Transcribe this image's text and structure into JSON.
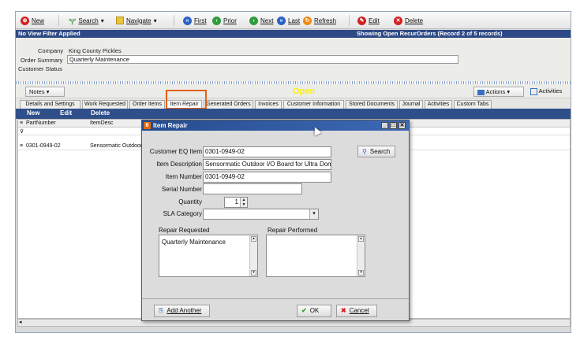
{
  "toolbar": {
    "new": "New",
    "search": "Search",
    "navigate": "Navigate",
    "first": "First",
    "prior": "Prior",
    "next": "Next",
    "last": "Last",
    "refresh": "Refresh",
    "edit": "Edit",
    "delete": "Delete"
  },
  "status": {
    "left": "No View Filter Applied",
    "right": "Showing Open RecurOrders  (Record 2 of 5 records)"
  },
  "form": {
    "company_label": "Company",
    "company_value": "King County Pickles",
    "summary_label": "Order Summary",
    "summary_value": "Quarterly Maintenance",
    "status_label": "Customer Status"
  },
  "bar": {
    "notes": "Notes",
    "open": "Open",
    "actions": "Actions",
    "activities": "Activities"
  },
  "tabs": [
    "Details and Settings",
    "Work Requested",
    "Order Items",
    "Item Repair",
    "Generated Orders",
    "Invoices",
    "Customer Information",
    "Stored Documents",
    "Journal",
    "Activities",
    "Custom Tabs"
  ],
  "actions": {
    "new": "New",
    "edit": "Edit",
    "delete": "Delete"
  },
  "grid": {
    "headers": [
      "PartNumber",
      "ItemDesc"
    ],
    "rows": [
      [
        "0301-0949-02",
        "Sensormatic Outdoor"
      ]
    ]
  },
  "dialog": {
    "title": "Item Repair",
    "eq_item_label": "Customer EQ Item",
    "eq_item_value": "0301-0949-02",
    "search_button": "Search",
    "description_label": "Item Description",
    "description_value": "Sensormatic Outdoor I/O Board for Ultra Dom",
    "item_number_label": "Item Number",
    "item_number_value": "0301-0949-02",
    "serial_label": "Serial Number",
    "serial_value": "",
    "quantity_label": "Quantity",
    "quantity_value": "1",
    "sla_label": "SLA Category",
    "sla_value": "",
    "repair_requested_label": "Repair Requested",
    "repair_requested_value": "Quarterly Maintenance",
    "repair_performed_label": "Repair Performed",
    "repair_performed_value": "",
    "add_another": "Add Another",
    "ok": "OK",
    "cancel": "Cancel"
  },
  "colors": {
    "header_blue": "#2e4a86",
    "highlight": "#e0601a",
    "open_yellow": "#f6ee1a"
  }
}
